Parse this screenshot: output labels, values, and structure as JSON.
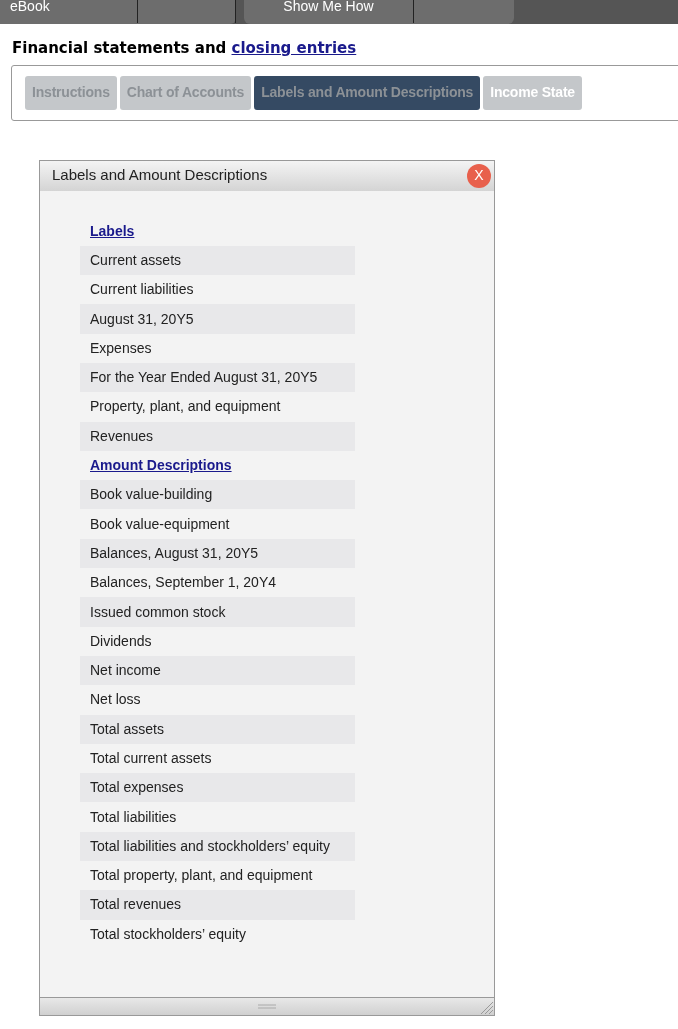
{
  "top_bar": {
    "tabs": [
      {
        "label": "eBook"
      },
      {
        "label": "Show Me How"
      }
    ]
  },
  "heading": {
    "text": "Financial statements and ",
    "link": "closing entries"
  },
  "tabs": [
    {
      "label": "Instructions",
      "selected": false,
      "completed": true
    },
    {
      "label": "Chart of Accounts",
      "selected": false,
      "completed": true
    },
    {
      "label": "Labels and Amount Descriptions",
      "selected": true,
      "completed": true
    },
    {
      "label": "Income State",
      "selected": false,
      "completed": false
    }
  ],
  "dialog": {
    "title": "Labels and Amount Descriptions",
    "close": "X",
    "sections": [
      {
        "heading": "Labels",
        "items": [
          "Current assets",
          "Current liabilities",
          "August 31, 20Y5",
          "Expenses",
          "For the Year Ended August 31, 20Y5",
          "Property, plant, and equipment",
          "Revenues"
        ]
      },
      {
        "heading": "Amount Descriptions",
        "items": [
          "Book value-building",
          "Book value-equipment",
          "Balances, August 31, 20Y5",
          "Balances, September 1, 20Y4",
          "Issued common stock",
          "Dividends",
          "Net income",
          "Net loss",
          "Total assets",
          "Total current assets",
          "Total expenses",
          "Total liabilities",
          "Total liabilities and stockholders’ equity",
          "Total property, plant, and equipment",
          "Total revenues",
          "Total stockholders’ equity"
        ]
      }
    ]
  }
}
